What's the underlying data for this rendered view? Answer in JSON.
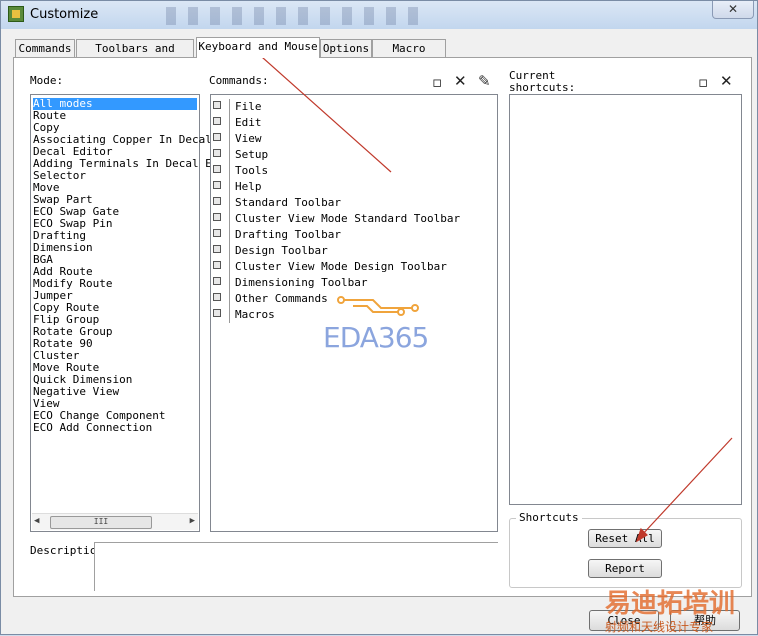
{
  "window": {
    "title": "Customize",
    "close_glyph": "✕"
  },
  "tabs": [
    {
      "label": "Commands"
    },
    {
      "label": "Toolbars and Menus"
    },
    {
      "label": "Keyboard and Mouse"
    },
    {
      "label": "Options"
    },
    {
      "label": "Macro Files"
    }
  ],
  "active_tab": "Keyboard and Mouse",
  "mode": {
    "label": "Mode:",
    "selected": "All modes",
    "items": [
      "All modes",
      "Route",
      "Copy",
      "Associating Copper In Decal",
      "Decal Editor",
      "Adding Terminals In Decal E",
      "Selector",
      "Move",
      "Swap Part",
      "ECO Swap Gate",
      "ECO Swap Pin",
      "Drafting",
      "Dimension",
      "BGA",
      "Add Route",
      "Modify Route",
      "Jumper",
      "Copy Route",
      "Flip Group",
      "Rotate Group",
      "Rotate 90",
      "Cluster",
      "Move Route",
      "Quick Dimension",
      "Negative View",
      "View",
      "ECO Change Component",
      "ECO Add Connection"
    ],
    "scroll_thumb": "III"
  },
  "commands": {
    "label": "Commands:",
    "items": [
      "File",
      "Edit",
      "View",
      "Setup",
      "Tools",
      "Help",
      "Standard Toolbar",
      "Cluster View Mode Standard Toolbar",
      "Drafting Toolbar",
      "Design Toolbar",
      "Cluster View Mode Design Toolbar",
      "Dimensioning Toolbar",
      "Other Commands",
      "Macros"
    ],
    "toolbar_icons": [
      "new-icon",
      "delete-icon",
      "edit-icon"
    ]
  },
  "shortcuts": {
    "label": "Current\nshortcuts:",
    "toolbar_icons": [
      "new-icon",
      "delete-icon"
    ],
    "group_title": "Shortcuts",
    "reset_label": "Reset All",
    "report_label": "Report"
  },
  "description": {
    "label": "Descriptic"
  },
  "footer": {
    "close_label": "Close",
    "help_label": "帮助"
  },
  "watermarks": {
    "eda": "EDA365",
    "cn": "易迪拓培训",
    "cn_sub": "射频和天线设计专家"
  },
  "colors": {
    "selection": "#3399ff",
    "annotation_arrow": "#c0392b",
    "watermark_blue": "#6f8fd6",
    "watermark_orange": "#e36a2a"
  }
}
